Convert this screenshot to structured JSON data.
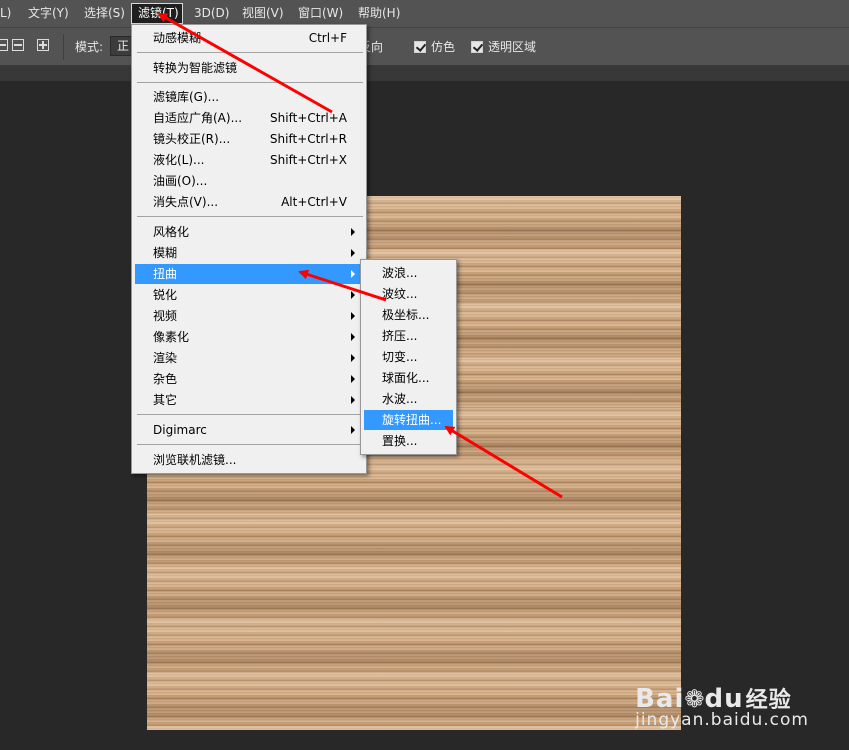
{
  "menubar": {
    "items": [
      {
        "label": "L)"
      },
      {
        "label": "文字(Y)"
      },
      {
        "label": "选择(S)"
      },
      {
        "label": "滤镜(T)"
      },
      {
        "label": "3D(D)"
      },
      {
        "label": "视图(V)"
      },
      {
        "label": "窗口(W)"
      },
      {
        "label": "帮助(H)"
      }
    ]
  },
  "options": {
    "mode_label": "模式:",
    "mode_value": "正",
    "checkboxes": [
      {
        "label": "反向"
      },
      {
        "label": "仿色"
      },
      {
        "label": "透明区域"
      }
    ]
  },
  "filter_menu": {
    "items": [
      {
        "label": "动感模糊",
        "shortcut": "Ctrl+F"
      },
      {
        "label": "转换为智能滤镜"
      },
      {
        "label": "滤镜库(G)..."
      },
      {
        "label": "自适应广角(A)...",
        "shortcut": "Shift+Ctrl+A"
      },
      {
        "label": "镜头校正(R)...",
        "shortcut": "Shift+Ctrl+R"
      },
      {
        "label": "液化(L)...",
        "shortcut": "Shift+Ctrl+X"
      },
      {
        "label": "油画(O)..."
      },
      {
        "label": "消失点(V)...",
        "shortcut": "Alt+Ctrl+V"
      },
      {
        "label": "风格化"
      },
      {
        "label": "模糊"
      },
      {
        "label": "扭曲"
      },
      {
        "label": "锐化"
      },
      {
        "label": "视频"
      },
      {
        "label": "像素化"
      },
      {
        "label": "渲染"
      },
      {
        "label": "杂色"
      },
      {
        "label": "其它"
      },
      {
        "label": "Digimarc"
      },
      {
        "label": "浏览联机滤镜..."
      }
    ]
  },
  "distort_submenu": {
    "items": [
      {
        "label": "波浪..."
      },
      {
        "label": "波纹..."
      },
      {
        "label": "极坐标..."
      },
      {
        "label": "挤压..."
      },
      {
        "label": "切变..."
      },
      {
        "label": "球面化..."
      },
      {
        "label": "水波..."
      },
      {
        "label": "旋转扭曲..."
      },
      {
        "label": "置换..."
      }
    ]
  },
  "watermark": {
    "logo": "Bai",
    "logo_du": "du",
    "logo_cn": "经验",
    "site": "jingyan.baidu.com"
  },
  "colors": {
    "highlight": "#3399ff",
    "annotation_arrow": "#ff0000"
  }
}
